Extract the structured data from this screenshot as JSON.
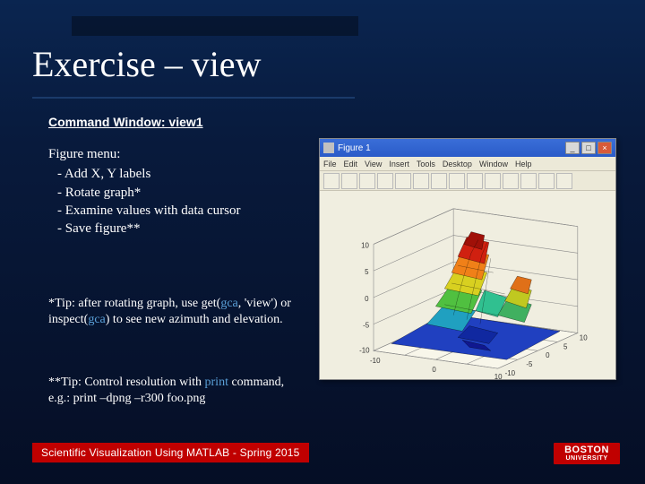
{
  "title": "Exercise – view",
  "subtitle": "Command Window: view1",
  "figure_menu": {
    "heading": "Figure menu:",
    "items": [
      "- Add X, Y labels",
      "- Rotate graph*",
      "- Examine values with data cursor",
      "- Save figure**"
    ]
  },
  "tip1_a": "*Tip: after rotating graph, use get(",
  "tip1_gca1": "gca",
  "tip1_b": ", 'view') or inspect(",
  "tip1_gca2": "gca",
  "tip1_c": ") to see new azimuth and elevation.",
  "tip2_a": "**Tip: Control resolution with ",
  "tip2_print": "print",
  "tip2_b": " command, e.g.: print –dpng –r300 foo.png",
  "footer": "Scientific Visualization Using MATLAB - Spring 2015",
  "logo": {
    "line1": "BOSTON",
    "line2": "UNIVERSITY"
  },
  "figwin": {
    "title": "Figure 1",
    "winbtn_min": "_",
    "winbtn_max": "□",
    "winbtn_close": "×",
    "menu": [
      "File",
      "Edit",
      "View",
      "Insert",
      "Tools",
      "Desktop",
      "Window",
      "Help"
    ],
    "toolbar_count": 14,
    "z_ticks": [
      "10",
      "5",
      "0",
      "-5",
      "-10"
    ],
    "x_ticks": [
      "-10",
      "0",
      "10"
    ],
    "y_ticks": [
      "-10",
      "-5",
      "0",
      "5",
      "10"
    ]
  },
  "chart_data": {
    "type": "surface",
    "title": "",
    "function": "z = f(x,y) (peaks-like surface)",
    "xlim": [
      -15,
      15
    ],
    "ylim": [
      -15,
      15
    ],
    "zlim": [
      -10,
      10
    ],
    "x_ticks": [
      -10,
      0,
      10
    ],
    "y_ticks": [
      -10,
      -5,
      0,
      5,
      10
    ],
    "z_ticks": [
      -10,
      -5,
      0,
      5,
      10
    ],
    "view_azimuth": -37.5,
    "view_elevation": 30,
    "colormap": "jet",
    "grid": true,
    "peaks": [
      {
        "x": -3,
        "y": 3,
        "z": 8
      },
      {
        "x": 2,
        "y": -2,
        "z": 4
      },
      {
        "x": 0,
        "y": -3,
        "z": -6
      }
    ]
  }
}
